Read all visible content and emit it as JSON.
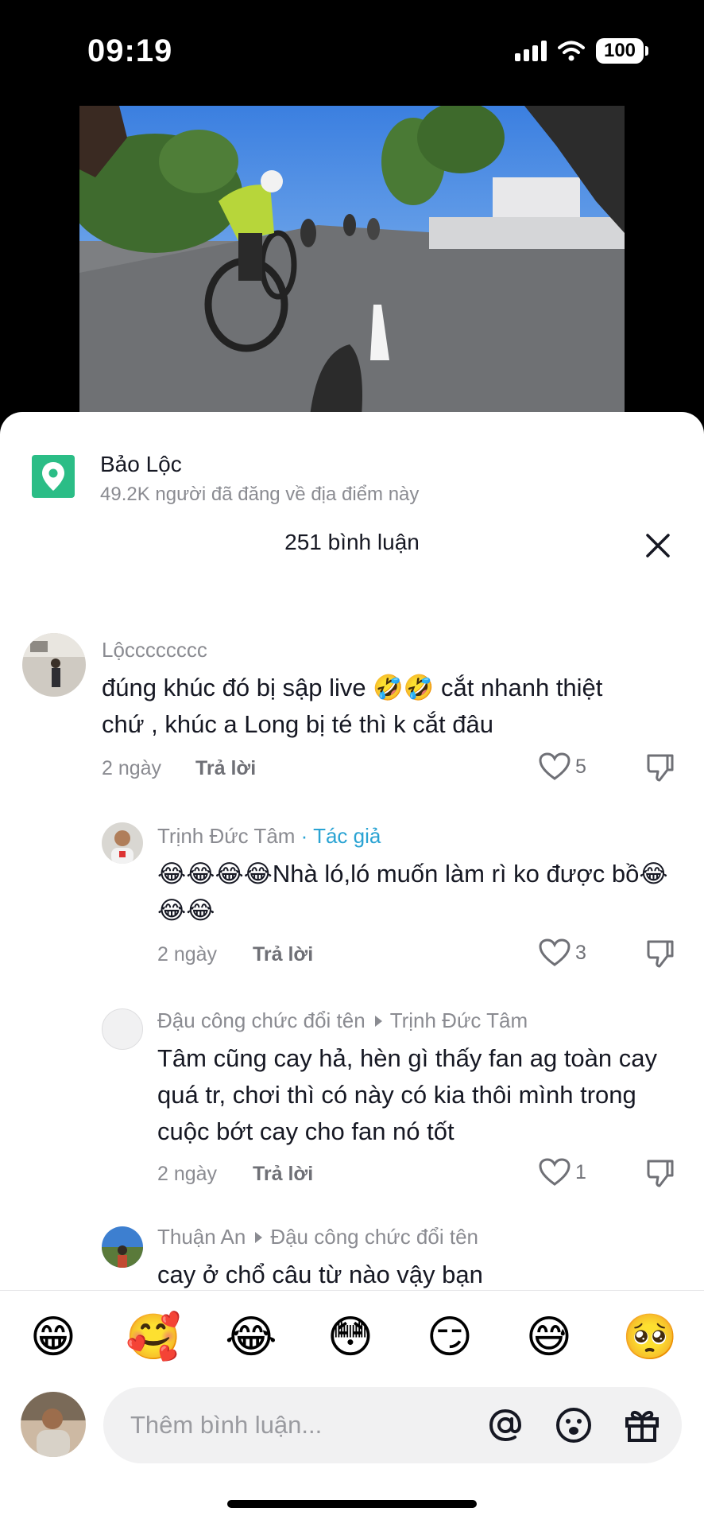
{
  "status_bar": {
    "time": "09:19",
    "battery": "100"
  },
  "location": {
    "name": "Bảo Lộc",
    "subtitle": "49.2K người đã đăng về địa điểm này"
  },
  "comments_header": {
    "title": "251 bình luận"
  },
  "comments": [
    {
      "user": "Lộcccccccc",
      "text": "đúng khúc đó bị sập live 🤣🤣 cắt nhanh thiệt chứ , khúc a Long bị té thì k cắt đâu",
      "time": "2 ngày",
      "reply_label": "Trả lời",
      "likes": "5"
    },
    {
      "user": "Trịnh Đức Tâm",
      "author_tag": "· Tác giả",
      "text": "😂😂😂😂Nhà ló,ló muốn làm rì ko được bồ😂😂😂",
      "time": "2 ngày",
      "reply_label": "Trả lời",
      "likes": "3"
    },
    {
      "user": "Đậu công chức đổi tên",
      "reply_to": "Trịnh Đức Tâm",
      "text": "Tâm cũng cay hả, hèn gì thấy fan ag toàn cay quá tr, chơi thì có này có kia thôi mình trong cuộc bớt cay cho fan nó tốt",
      "time": "2 ngày",
      "reply_label": "Trả lời",
      "likes": "1"
    },
    {
      "user": "Thuận An",
      "reply_to": "Đậu công chức đổi tên",
      "text": "cay ở chổ câu từ nào vậy bạn"
    }
  ],
  "emoji_bar": [
    "😁",
    "🥰",
    "😂",
    "😳",
    "😏",
    "😅",
    "🥺"
  ],
  "input": {
    "placeholder": "Thêm bình luận..."
  },
  "colors": {
    "accent": "#2aa3d3",
    "location_pin": "#2bbd86",
    "text_primary": "#161823",
    "text_secondary": "#8a8b91"
  },
  "icons": [
    "signal-icon",
    "wifi-icon",
    "battery-icon",
    "location-pin-icon",
    "close-icon",
    "heart-icon",
    "dislike-icon",
    "mention-icon",
    "emoji-icon",
    "gift-icon"
  ]
}
